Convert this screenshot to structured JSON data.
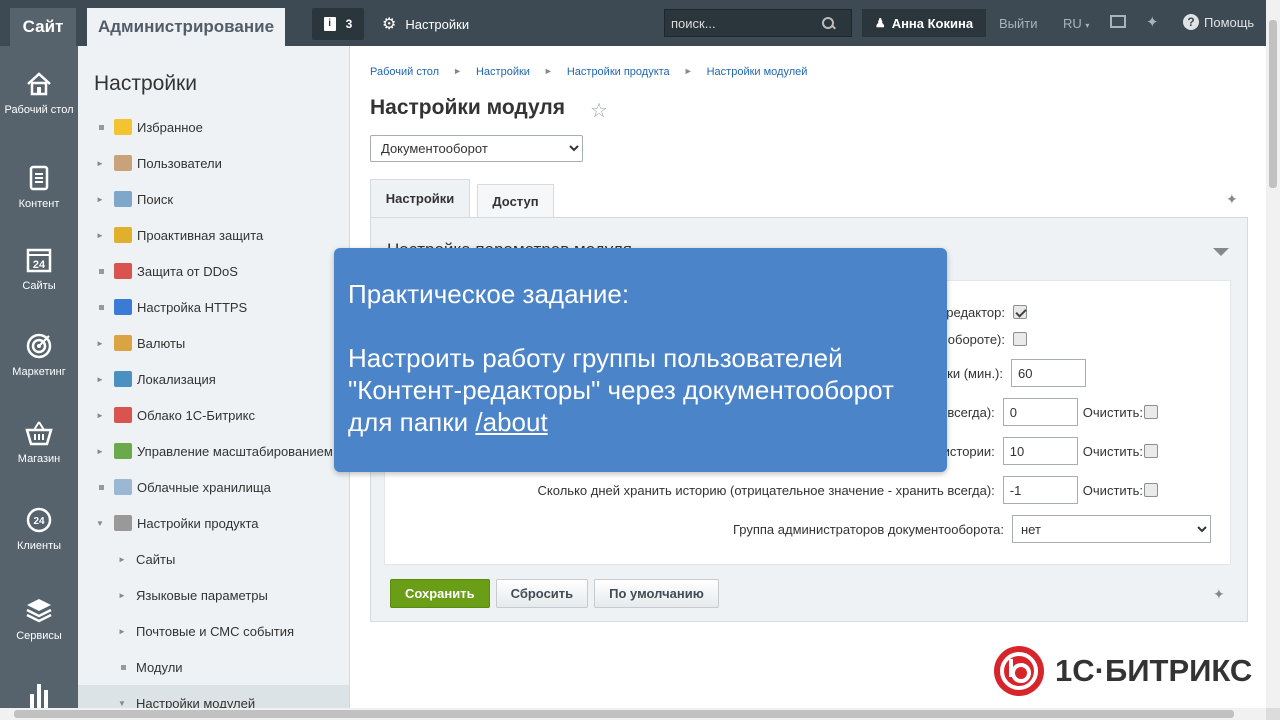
{
  "topbar": {
    "site": "Сайт",
    "admin": "Администрирование",
    "notifications_count": "3",
    "notif_icon": "i",
    "settings": "Настройки",
    "search_placeholder": "поиск...",
    "user": "Анна Кокина",
    "logout": "Выйти",
    "lang": "RU",
    "help": "Помощь"
  },
  "iconbar": [
    {
      "label": "Рабочий стол",
      "icon": "home-icon"
    },
    {
      "label": "Контент",
      "icon": "document-icon"
    },
    {
      "label": "Сайты",
      "icon": "calendar-24-icon"
    },
    {
      "label": "Маркетинг",
      "icon": "target-icon"
    },
    {
      "label": "Магазин",
      "icon": "basket-icon"
    },
    {
      "label": "Клиенты",
      "icon": "clients-24-icon"
    },
    {
      "label": "Сервисы",
      "icon": "layers-icon"
    }
  ],
  "iconbar_badges": {
    "sites": "24",
    "clients": "24"
  },
  "menu": {
    "title": "Настройки",
    "items": [
      {
        "label": "Избранное",
        "marker": "dot",
        "icon": "star-icon",
        "color": "#f4c430"
      },
      {
        "label": "Пользователи",
        "marker": "arrow",
        "icon": "user-icon",
        "color": "#c9a27a"
      },
      {
        "label": "Поиск",
        "marker": "arrow",
        "icon": "magnifier-icon",
        "color": "#7fa7c9"
      },
      {
        "label": "Проактивная защита",
        "marker": "arrow",
        "icon": "lock-icon",
        "color": "#e0b02c"
      },
      {
        "label": "Защита от DDoS",
        "marker": "dot",
        "icon": "shield-icon",
        "color": "#d9534f"
      },
      {
        "label": "Настройка HTTPS",
        "marker": "dot",
        "icon": "https-lock-icon",
        "color": "#3a7bd5"
      },
      {
        "label": "Валюты",
        "marker": "arrow",
        "icon": "coin-icon",
        "color": "#d9a441"
      },
      {
        "label": "Локализация",
        "marker": "arrow",
        "icon": "globe-icon",
        "color": "#4a90c2"
      },
      {
        "label": "Облако 1С-Битрикс",
        "marker": "arrow",
        "icon": "cloud-icon",
        "color": "#d9534f"
      },
      {
        "label": "Управление масштабированием",
        "marker": "arrow",
        "icon": "servers-icon",
        "color": "#6aaa4a"
      },
      {
        "label": "Облачные хранилища",
        "marker": "dot",
        "icon": "storage-icon",
        "color": "#9ab7d3"
      },
      {
        "label": "Настройки продукта",
        "marker": "arrow-open",
        "icon": "gear-icon",
        "color": "#999999"
      },
      {
        "label": "Сайты",
        "marker": "arrow",
        "sub": true
      },
      {
        "label": "Языковые параметры",
        "marker": "arrow",
        "sub": true
      },
      {
        "label": "Почтовые и СМС события",
        "marker": "arrow",
        "sub": true
      },
      {
        "label": "Модули",
        "marker": "dot",
        "sub": true
      },
      {
        "label": "Настройки модулей",
        "marker": "arrow-open",
        "sub": true,
        "active": true
      }
    ]
  },
  "breadcrumbs": [
    "Рабочий стол",
    "Настройки",
    "Настройки продукта",
    "Настройки модулей"
  ],
  "page_title": "Настройки модуля",
  "module_select": "Документооборот",
  "tabs": [
    "Настройки",
    "Доступ"
  ],
  "panel": {
    "heading": "Настройка параметров модуля",
    "rows": [
      {
        "label": "редактор:",
        "type": "checkbox",
        "checked": true
      },
      {
        "label": "оборотe):",
        "type": "checkbox",
        "checked": false
      },
      {
        "label": "ки (мин.):",
        "type": "input",
        "value": "60"
      },
      {
        "label": "ь всегда):",
        "type": "input-clear",
        "value": "0",
        "clear": "Очистить:"
      },
      {
        "label": "истории:",
        "type": "input-clear",
        "value": "10",
        "clear": "Очистить:"
      },
      {
        "label": "Сколько дней хранить историю (отрицательное значение - хранить всегда):",
        "type": "input-clear",
        "value": "-1",
        "clear": "Очистить:"
      },
      {
        "label": "Группа администраторов документооборота:",
        "type": "select",
        "value": "нет"
      }
    ]
  },
  "buttons": {
    "save": "Сохранить",
    "reset": "Сбросить",
    "default": "По умолчанию"
  },
  "overlay": {
    "title": "Практическое задание:",
    "body": "Настроить работу группы пользователей \"Контент-редакторы\" через документооборот для папки ",
    "link": "/about "
  },
  "logo": "1С·БИТРИКС",
  "colors": {
    "topbar": "#3d4a53",
    "iconbar": "#56636d",
    "overlay": "#4b84c9",
    "save": "#6b9e17",
    "logo_red": "#d7262b"
  }
}
